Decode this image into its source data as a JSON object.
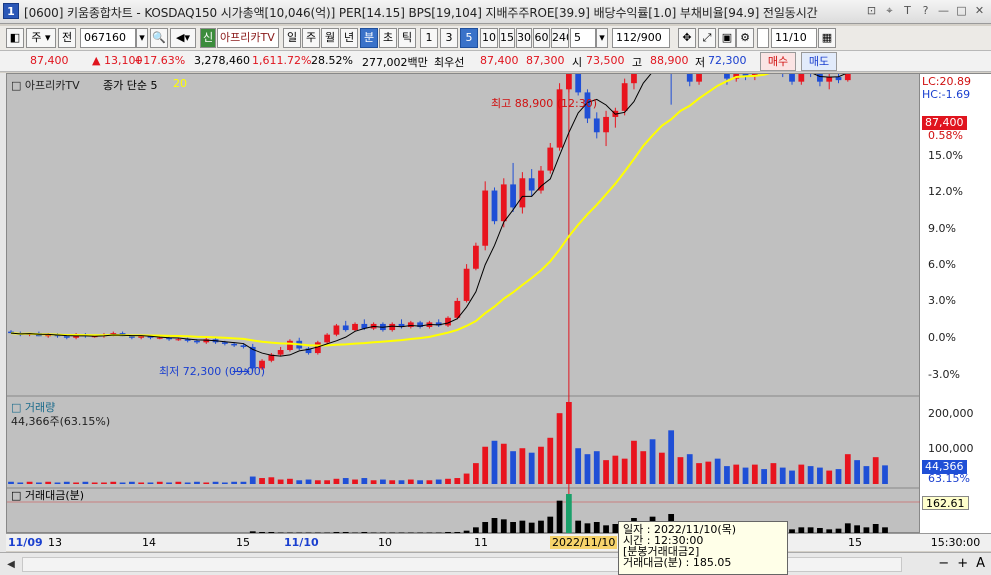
{
  "titlebar": {
    "window_number": "1",
    "title": "[0600] 키움종합차트 - KOSDAQ150 시가총액[10,046(억)] PER[14.15] BPS[19,104] 지배주주ROE[39.9] 배당수익률[1.0] 부채비율[94.9] 전일동시간",
    "icons": [
      "restore-icon",
      "pin-icon",
      "text-icon",
      "help-icon",
      "minimize-icon",
      "maximize-icon",
      "close-icon"
    ],
    "icon_glyphs": [
      "⊡",
      "⌖",
      "T",
      "?",
      "—",
      "□",
      "✕"
    ]
  },
  "toolbar": {
    "period_label": "주",
    "prev_label": "전",
    "stock_code": "067160",
    "credit_label": "신",
    "stock_name": "아프리카TV",
    "period_tabs": [
      "일",
      "주",
      "월",
      "년",
      "분",
      "초",
      "틱"
    ],
    "interval_buttons": [
      "1",
      "3",
      "5",
      "10",
      "15",
      "30",
      "60",
      "240"
    ],
    "selected_interval": "5",
    "interval_value": "5",
    "count_value": "112",
    "count_total": "/900",
    "date_value": "11/10"
  },
  "quote": {
    "price": "87,400",
    "change": "▲ 13,100",
    "change_pct": "+17.63%",
    "volume": "3,278,460",
    "volume_ratio": "1,611.72%",
    "turnover": "28.52%",
    "amount": "277,002백만",
    "best_label": "최우선",
    "ask": "87,400",
    "bid": "87,300",
    "open_label": "시",
    "open": "73,500",
    "high_label": "고",
    "high": "88,900",
    "low_label": "저",
    "low": "72,300",
    "buy_label": "매수",
    "sell_label": "매도"
  },
  "chart": {
    "legend_name": "아프리카TV",
    "legend_ma": "종가 단순 5",
    "legend_ma_20": "20",
    "high_marker": "최고 88,900 (12:30)",
    "low_marker": "최저 72,300 (09:00)",
    "lc": "LC:20.89",
    "hc": "HC:-1.69",
    "price_tag": "87,400",
    "pct_tag": "0.58%",
    "y_labels": [
      "15.0%",
      "12.0%",
      "9.0%",
      "6.0%",
      "3.0%",
      "0.0%",
      "-3.0%"
    ],
    "volume_title": "거래량",
    "volume_value": "44,366주(63.15%)",
    "volume_y_labels": [
      "200,000",
      "100,000"
    ],
    "volume_tag": "44,366",
    "volume_tag_pct": "63.15%",
    "amount_title": "거래대금(분)",
    "amount_tag": "162.61",
    "colors": {
      "up": "#e8141e",
      "down": "#1f4fd6",
      "ma5": "#000000",
      "ma20": "#ffff00",
      "bg": "#c0c0c0"
    }
  },
  "date_axis": {
    "labels": [
      "11/09",
      "13",
      "14",
      "15",
      "11/10",
      "10",
      "11",
      "2022/11/10",
      "15"
    ],
    "time": "15:30:00"
  },
  "tooltip": {
    "rows": [
      "일자     : 2022/11/10(목)",
      "시간     : 12:30:00",
      "[분봉거래대금2]",
      "거래대금(분) : 185.05"
    ]
  },
  "chart_data": {
    "type": "candlestick",
    "y_unit": "percent change",
    "ylim": [
      -4,
      17
    ],
    "candles": [
      [
        0.2,
        0.3,
        0.1,
        0.1
      ],
      [
        0.1,
        0.2,
        -0.1,
        0.0
      ],
      [
        0.0,
        0.1,
        -0.1,
        0.1
      ],
      [
        0.1,
        0.2,
        -0.1,
        -0.1
      ],
      [
        -0.1,
        0.1,
        -0.2,
        0.0
      ],
      [
        0.0,
        0.1,
        -0.2,
        -0.1
      ],
      [
        -0.1,
        0.0,
        -0.3,
        -0.2
      ],
      [
        -0.2,
        0.1,
        -0.3,
        0.0
      ],
      [
        0.0,
        0.1,
        -0.2,
        -0.1
      ],
      [
        -0.1,
        0.0,
        -0.2,
        -0.1
      ],
      [
        -0.1,
        0.1,
        -0.2,
        0.0
      ],
      [
        0.0,
        0.2,
        -0.1,
        0.1
      ],
      [
        0.1,
        0.2,
        -0.1,
        -0.1
      ],
      [
        -0.1,
        0.0,
        -0.3,
        -0.2
      ],
      [
        -0.2,
        0.0,
        -0.3,
        -0.1
      ],
      [
        -0.1,
        0.0,
        -0.3,
        -0.2
      ],
      [
        -0.2,
        -0.1,
        -0.3,
        -0.2
      ],
      [
        -0.2,
        -0.1,
        -0.4,
        -0.3
      ],
      [
        -0.3,
        -0.2,
        -0.4,
        -0.3
      ],
      [
        -0.3,
        -0.2,
        -0.5,
        -0.4
      ],
      [
        -0.4,
        -0.3,
        -0.6,
        -0.5
      ],
      [
        -0.5,
        -0.2,
        -0.6,
        -0.3
      ],
      [
        -0.3,
        -0.2,
        -0.6,
        -0.5
      ],
      [
        -0.5,
        -0.4,
        -0.7,
        -0.6
      ],
      [
        -0.6,
        -0.5,
        -0.8,
        -0.7
      ],
      [
        -0.7,
        -0.6,
        -0.9,
        -0.8
      ],
      [
        -0.8,
        -0.6,
        -2.4,
        -2.2
      ],
      [
        -2.2,
        -1.6,
        -2.3,
        -1.7
      ],
      [
        -1.7,
        -1.2,
        -1.8,
        -1.3
      ],
      [
        -1.3,
        -0.8,
        -1.4,
        -1.0
      ],
      [
        -1.0,
        -0.3,
        -1.1,
        -0.4
      ],
      [
        -0.4,
        -0.2,
        -1.0,
        -0.9
      ],
      [
        -0.9,
        -0.8,
        -1.3,
        -1.2
      ],
      [
        -1.2,
        -0.4,
        -1.3,
        -0.5
      ],
      [
        -0.5,
        0.1,
        -0.6,
        0.0
      ],
      [
        0.0,
        0.7,
        -0.1,
        0.6
      ],
      [
        0.6,
        0.9,
        0.2,
        0.3
      ],
      [
        0.3,
        0.8,
        0.2,
        0.7
      ],
      [
        0.7,
        1.0,
        0.3,
        0.4
      ],
      [
        0.4,
        0.8,
        0.3,
        0.7
      ],
      [
        0.7,
        0.8,
        0.2,
        0.3
      ],
      [
        0.3,
        0.8,
        0.2,
        0.7
      ],
      [
        0.7,
        1.0,
        0.4,
        0.5
      ],
      [
        0.5,
        0.9,
        0.4,
        0.8
      ],
      [
        0.8,
        0.9,
        0.4,
        0.5
      ],
      [
        0.5,
        0.9,
        0.4,
        0.8
      ],
      [
        0.8,
        1.0,
        0.5,
        0.6
      ],
      [
        0.6,
        1.2,
        0.5,
        1.1
      ],
      [
        1.1,
        2.4,
        1.0,
        2.2
      ],
      [
        2.2,
        4.6,
        2.1,
        4.3
      ],
      [
        4.3,
        6.0,
        4.2,
        5.8
      ],
      [
        5.8,
        10.0,
        5.5,
        9.4
      ],
      [
        9.4,
        9.6,
        7.2,
        7.4
      ],
      [
        7.4,
        10.2,
        7.0,
        9.8
      ],
      [
        9.8,
        11.2,
        8.0,
        8.3
      ],
      [
        8.3,
        10.6,
        7.9,
        10.2
      ],
      [
        10.2,
        10.8,
        9.0,
        9.4
      ],
      [
        9.4,
        11.0,
        9.2,
        10.7
      ],
      [
        10.7,
        12.5,
        10.5,
        12.2
      ],
      [
        12.2,
        16.4,
        12.0,
        16.0
      ],
      [
        16.0,
        20.9,
        15.8,
        17.6
      ],
      [
        17.6,
        18.0,
        15.6,
        15.8
      ],
      [
        15.8,
        16.0,
        13.8,
        14.1
      ],
      [
        14.1,
        14.5,
        12.8,
        13.2
      ],
      [
        13.2,
        14.6,
        12.3,
        14.2
      ],
      [
        14.2,
        14.8,
        13.5,
        14.6
      ],
      [
        14.6,
        16.7,
        14.3,
        16.4
      ],
      [
        16.4,
        18.0,
        16.0,
        17.6
      ],
      [
        17.6,
        19.5,
        17.2,
        19.2
      ],
      [
        19.2,
        19.8,
        17.6,
        17.9
      ],
      [
        17.9,
        20.4,
        17.6,
        18.5
      ],
      [
        18.5,
        19.9,
        15.0,
        17.8
      ],
      [
        17.8,
        18.8,
        17.5,
        18.4
      ],
      [
        18.4,
        18.7,
        16.2,
        16.5
      ],
      [
        16.5,
        18.2,
        16.3,
        17.8
      ],
      [
        17.8,
        18.8,
        17.4,
        18.6
      ],
      [
        18.6,
        18.8,
        17.3,
        17.6
      ],
      [
        17.6,
        18.3,
        16.3,
        16.7
      ],
      [
        16.7,
        17.9,
        16.5,
        17.6
      ],
      [
        17.6,
        17.9,
        16.6,
        16.9
      ],
      [
        16.9,
        18.4,
        16.6,
        18.1
      ],
      [
        18.1,
        18.3,
        17.0,
        17.3
      ],
      [
        17.3,
        18.0,
        17.1,
        17.8
      ],
      [
        17.8,
        18.0,
        16.8,
        17.0
      ],
      [
        17.0,
        17.6,
        16.3,
        16.5
      ],
      [
        16.5,
        17.5,
        16.3,
        17.2
      ],
      [
        17.2,
        17.5,
        16.8,
        17.0
      ],
      [
        17.0,
        17.4,
        16.2,
        16.5
      ],
      [
        16.5,
        17.1,
        16.0,
        16.8
      ],
      [
        16.8,
        17.2,
        16.4,
        16.6
      ],
      [
        16.6,
        18.7,
        16.5,
        18.5
      ],
      [
        18.5,
        18.9,
        17.6,
        17.9
      ],
      [
        17.9,
        18.2,
        17.3,
        17.6
      ],
      [
        17.6,
        19.4,
        17.4,
        18.2
      ],
      [
        18.2,
        18.4,
        17.5,
        17.8
      ]
    ],
    "volume": [
      3,
      2,
      3,
      2,
      3,
      2,
      3,
      2,
      3,
      2,
      2,
      3,
      2,
      3,
      2,
      2,
      3,
      2,
      3,
      2,
      3,
      2,
      3,
      2,
      3,
      3,
      10,
      8,
      9,
      6,
      7,
      5,
      6,
      5,
      5,
      7,
      8,
      6,
      8,
      5,
      6,
      5,
      5,
      6,
      5,
      5,
      6,
      7,
      8,
      14,
      28,
      50,
      58,
      54,
      44,
      48,
      42,
      50,
      62,
      95,
      110,
      48,
      40,
      44,
      32,
      38,
      34,
      58,
      44,
      60,
      42,
      72,
      36,
      40,
      28,
      30,
      34,
      24,
      26,
      22,
      26,
      20,
      28,
      22,
      18,
      26,
      24,
      22,
      18,
      20,
      40,
      32,
      24,
      36,
      25
    ],
    "amount": [
      1,
      1,
      1,
      1,
      1,
      1,
      1,
      1,
      1,
      1,
      1,
      1,
      1,
      1,
      1,
      1,
      1,
      1,
      1,
      1,
      1,
      1,
      1,
      1,
      1,
      1,
      4,
      3,
      3,
      2,
      2,
      2,
      2,
      2,
      2,
      3,
      3,
      2,
      3,
      2,
      2,
      2,
      2,
      2,
      2,
      2,
      2,
      3,
      3,
      5,
      10,
      18,
      24,
      22,
      18,
      20,
      17,
      20,
      26,
      50,
      60,
      20,
      16,
      18,
      13,
      15,
      14,
      24,
      18,
      26,
      17,
      30,
      14,
      16,
      11,
      12,
      14,
      10,
      10,
      9,
      10,
      8,
      11,
      9,
      7,
      10,
      10,
      9,
      7,
      8,
      16,
      13,
      10,
      15,
      10
    ]
  }
}
